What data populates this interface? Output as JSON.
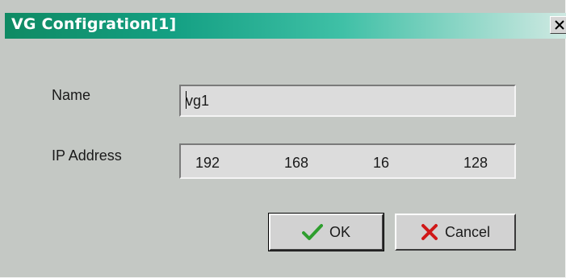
{
  "window": {
    "title": "VG Configration[1]",
    "close_icon": "close-x-icon"
  },
  "form": {
    "name_label": "Name",
    "name_value": "vg1",
    "ip_label": "IP Address",
    "ip_octets": [
      "192",
      "168",
      "16",
      "128"
    ]
  },
  "buttons": {
    "ok_label": "OK",
    "ok_icon": "checkmark-icon",
    "cancel_label": "Cancel",
    "cancel_icon": "red-x-icon"
  },
  "colors": {
    "titlebar_start": "#0f8a63",
    "titlebar_end": "#cfe9e2",
    "dialog_bg": "#c4c8c4",
    "ok_icon": "#2e9e2e",
    "cancel_icon": "#d01818"
  }
}
